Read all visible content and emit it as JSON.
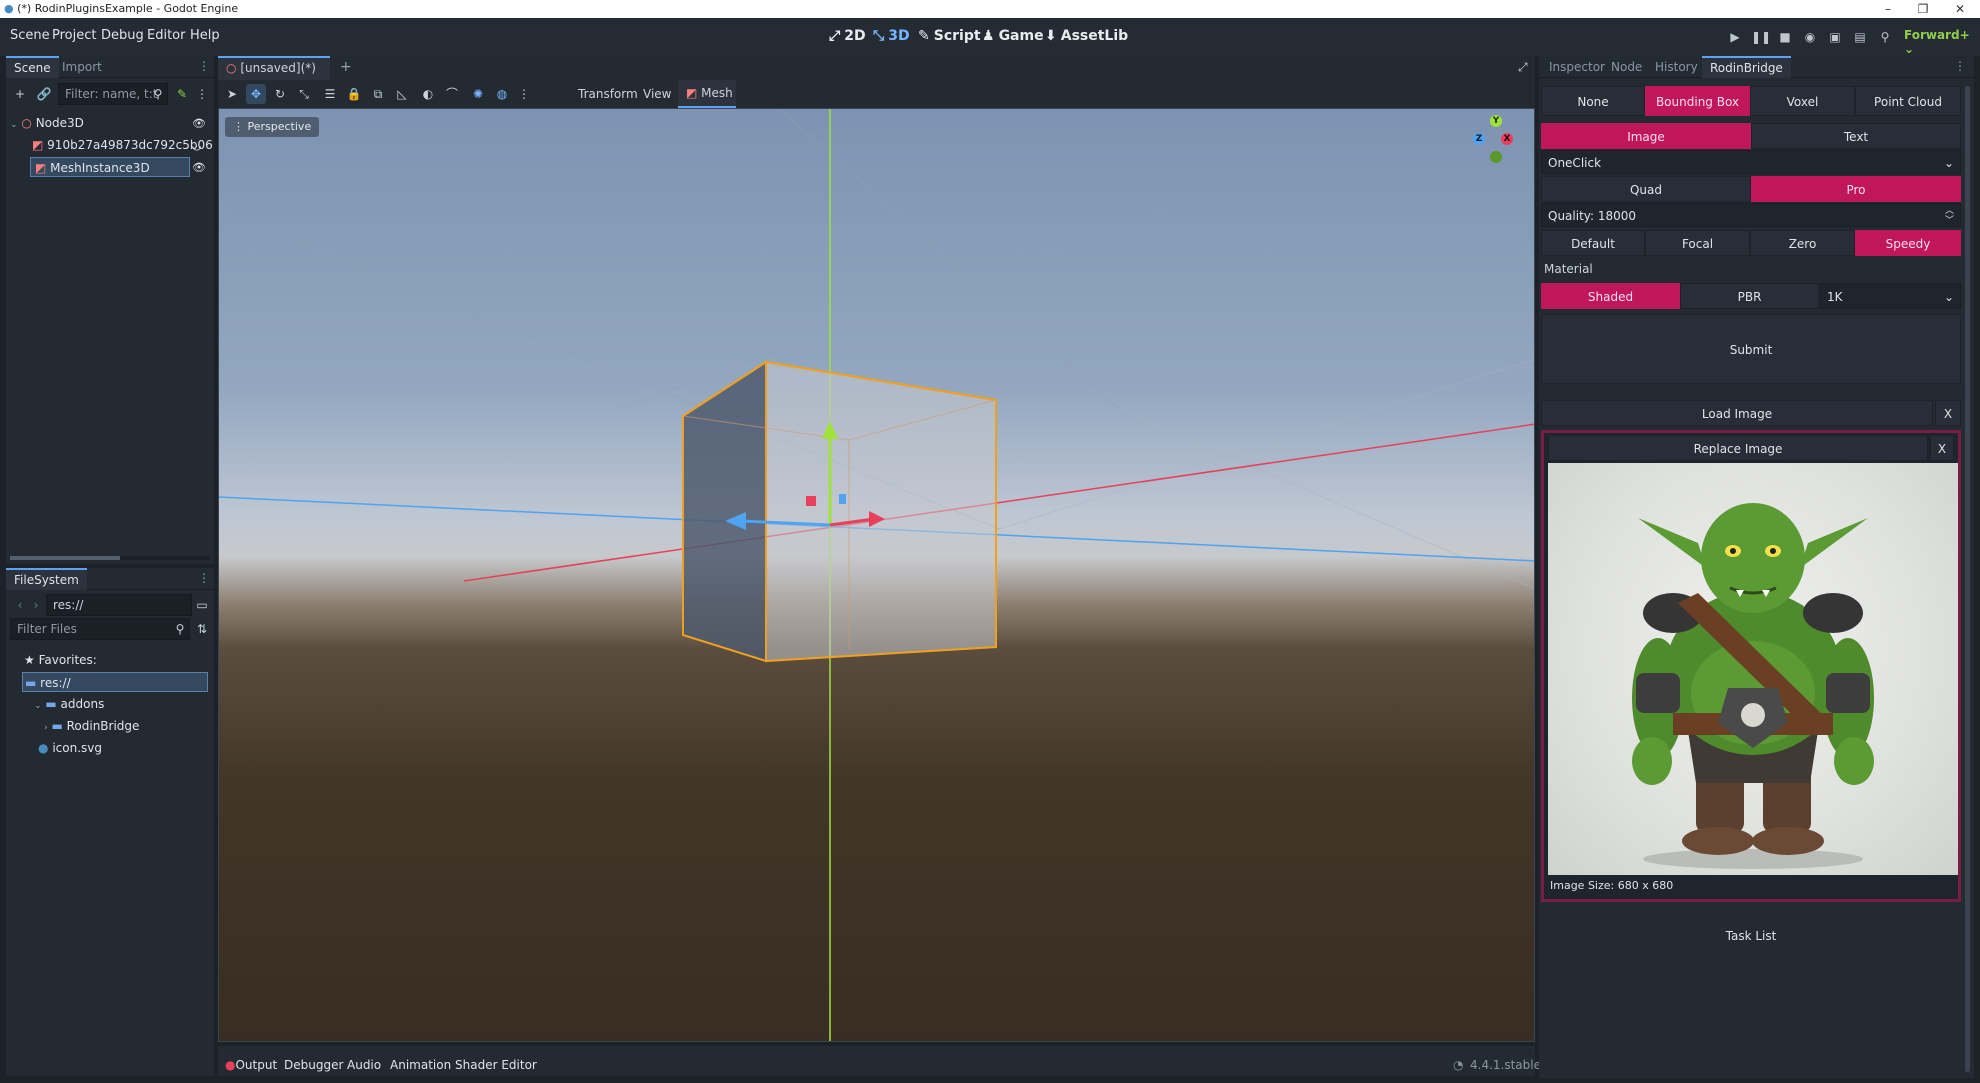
{
  "window": {
    "title": "(*) RodinPluginsExample - Godot Engine",
    "minimize": "–",
    "maximize": "❐",
    "close": "✕"
  },
  "menu": [
    "Scene",
    "Project",
    "Debug",
    "Editor",
    "Help"
  ],
  "workspaces": [
    {
      "icon": "⤢",
      "label": "2D"
    },
    {
      "icon": "⤡",
      "label": "3D"
    },
    {
      "icon": "✎",
      "label": "Script"
    },
    {
      "icon": "♟",
      "label": "Game"
    },
    {
      "icon": "⬇",
      "label": "AssetLib"
    }
  ],
  "renderer": "Forward+",
  "scene_dock": {
    "tabs": [
      "Scene",
      "Import"
    ],
    "filter_placeholder": "Filter: name, t:t",
    "nodes": [
      {
        "label": "Node3D"
      },
      {
        "label": "910b27a49873dc792c5b06"
      },
      {
        "label": "MeshInstance3D"
      }
    ]
  },
  "filesystem_dock": {
    "title": "FileSystem",
    "path": "res://",
    "filter_placeholder": "Filter Files",
    "items": [
      {
        "label": "Favorites:"
      },
      {
        "label": "res://"
      },
      {
        "label": "addons"
      },
      {
        "label": "RodinBridge"
      },
      {
        "label": "icon.svg"
      }
    ]
  },
  "editor_tabs": {
    "scene_tab": "[unsaved](*)",
    "add": "+"
  },
  "viewport_toolbar": {
    "transform": "Transform",
    "view": "View",
    "mesh": "Mesh",
    "perspective": "Perspective"
  },
  "gizmo": {
    "y": "Y",
    "z": "Z",
    "x": "X"
  },
  "inspector_tabs": [
    "Inspector",
    "Node",
    "History",
    "RodinBridge"
  ],
  "rodin": {
    "gen_modes": [
      "None",
      "Bounding Box",
      "Voxel",
      "Point Cloud"
    ],
    "input_modes": [
      "Image",
      "Text"
    ],
    "pipeline": "OneClick",
    "mesh_modes": [
      "Quad",
      "Pro"
    ],
    "quality_label": "Quality:",
    "quality_value": "18000",
    "tiers": [
      "Default",
      "Focal",
      "Zero",
      "Speedy"
    ],
    "material_label": "Material",
    "materials": [
      "Shaded",
      "PBR"
    ],
    "resolution": "1K",
    "submit": "Submit",
    "load_image": "Load Image",
    "load_close": "X",
    "replace_image": "Replace Image",
    "replace_close": "X",
    "image_size": "Image Size: 680 x 680",
    "task_list": "Task List"
  },
  "bottom_panel": [
    "Output",
    "Debugger",
    "Audio",
    "Animation",
    "Shader Editor"
  ],
  "version": "4.4.1.stable",
  "colors": {
    "accent": "#c0175a",
    "selection_blue": "#5ea3f2"
  }
}
